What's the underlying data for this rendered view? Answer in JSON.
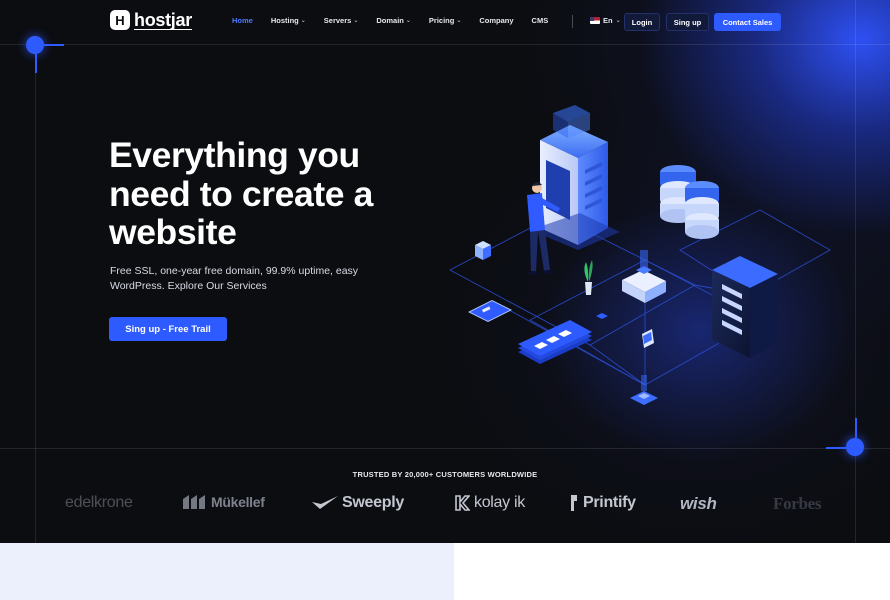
{
  "brand": {
    "logo_letter": "H",
    "name": "hostjar"
  },
  "nav": {
    "items": [
      {
        "label": "Home",
        "active": true,
        "dropdown": false
      },
      {
        "label": "Hosting",
        "active": false,
        "dropdown": true
      },
      {
        "label": "Servers",
        "active": false,
        "dropdown": true
      },
      {
        "label": "Domain",
        "active": false,
        "dropdown": true
      },
      {
        "label": "Pricing",
        "active": false,
        "dropdown": true
      },
      {
        "label": "Company",
        "active": false,
        "dropdown": false
      },
      {
        "label": "CMS",
        "active": false,
        "dropdown": false
      }
    ],
    "language": "En",
    "login_label": "Login",
    "signup_label": "Sing up",
    "contact_label": "Contact Sales"
  },
  "hero": {
    "headline": "Everything you need to create a website",
    "subtitle": "Free SSL, one-year free domain, 99.9% uptime, easy WordPress. Explore Our Services",
    "cta_label": "Sing up - Free Trail"
  },
  "trusted": {
    "title": "TRUSTED BY 20,000+ CUSTOMERS WORLDWIDE",
    "logos": [
      {
        "name": "edelkrone",
        "icon": "none"
      },
      {
        "name": "Mükellef",
        "icon": "mukellef-mark-icon"
      },
      {
        "name": "Sweeply",
        "icon": "sweeply-check-icon"
      },
      {
        "name": "kolay ik",
        "icon": "kolayik-k-icon"
      },
      {
        "name": "Printify",
        "icon": "printify-mark-icon"
      },
      {
        "name": "wish",
        "icon": "none"
      },
      {
        "name": "Forbes",
        "icon": "none"
      }
    ]
  },
  "colors": {
    "accent": "#2e5bff",
    "background": "#0c0d11",
    "below_left": "#ecf0fd"
  }
}
